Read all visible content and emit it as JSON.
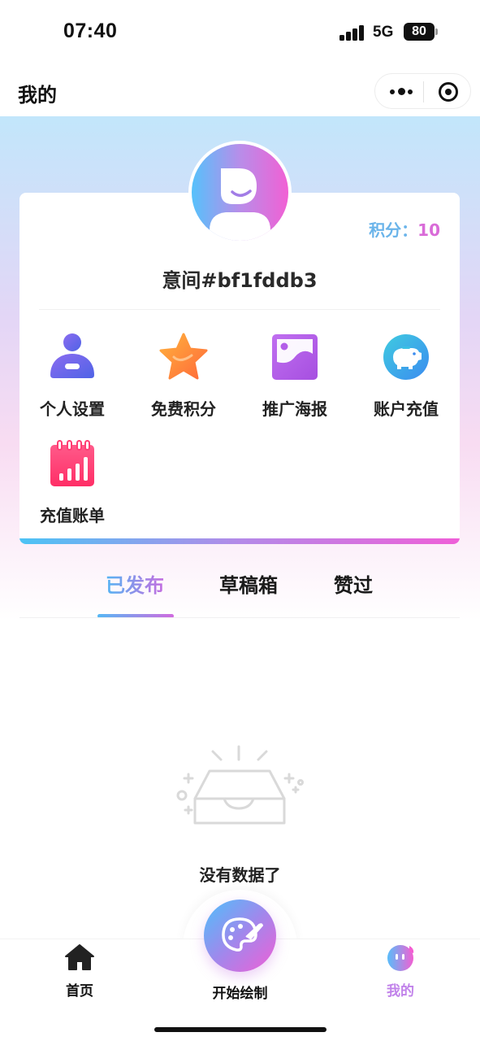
{
  "status_bar": {
    "time": "07:40",
    "network": "5G",
    "battery": "80"
  },
  "nav": {
    "title": "我的"
  },
  "profile": {
    "points_label": "积分：",
    "points_value": "10",
    "username": "意间#bf1fddb3"
  },
  "menu": [
    {
      "label": "个人设置",
      "icon": "person-icon"
    },
    {
      "label": "免费积分",
      "icon": "star-icon"
    },
    {
      "label": "推广海报",
      "icon": "poster-icon"
    },
    {
      "label": "账户充值",
      "icon": "piggy-bank-icon"
    },
    {
      "label": "充值账单",
      "icon": "bill-chart-icon"
    }
  ],
  "tabs": [
    {
      "label": "已发布",
      "active": true
    },
    {
      "label": "草稿箱",
      "active": false
    },
    {
      "label": "赞过",
      "active": false
    }
  ],
  "empty_state": {
    "text": "没有数据了"
  },
  "tabbar": {
    "home_label": "首页",
    "draw_label": "开始绘制",
    "mine_label": "我的"
  },
  "colors": {
    "accent_blue": "#55b7f4",
    "accent_pink": "#ef5fd8",
    "accent_purple": "#b48ae8"
  }
}
